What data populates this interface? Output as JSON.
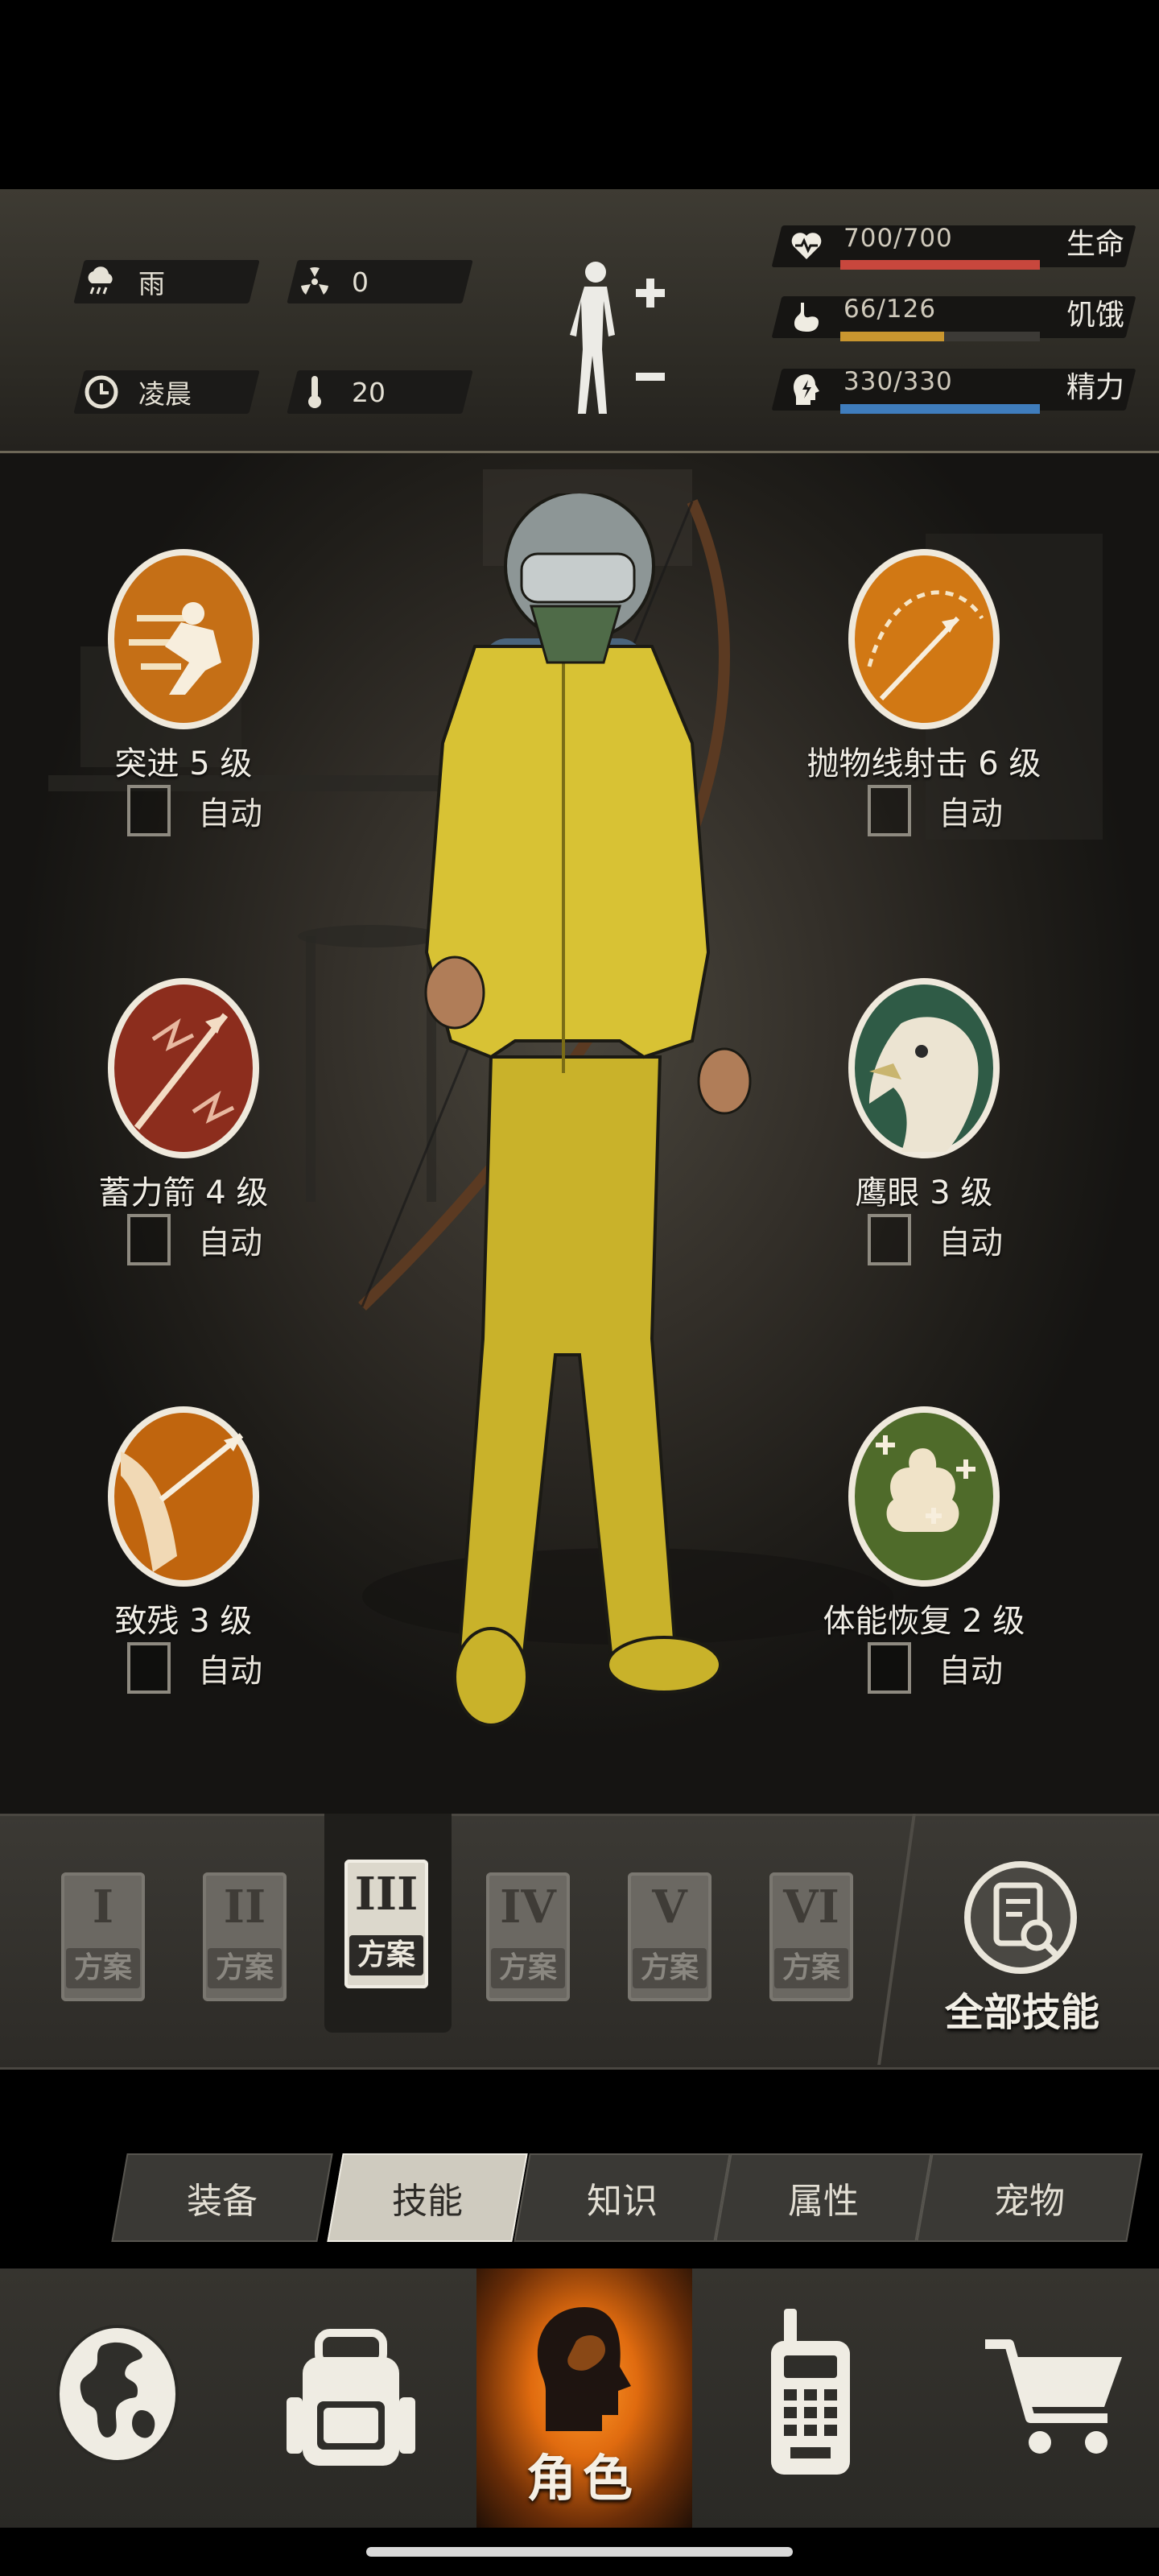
{
  "status": {
    "weather": {
      "icon": "rain-cloud-icon",
      "label": "雨"
    },
    "radiation": {
      "icon": "radiation-icon",
      "value": "0"
    },
    "time_of_day": {
      "icon": "clock-icon",
      "label": "凌晨"
    },
    "temperature": {
      "icon": "thermometer-icon",
      "value": "20"
    },
    "body_icon": "body-figure-icon",
    "bars": [
      {
        "key": "life",
        "label": "生命",
        "value": "700/700",
        "fraction": 1.0,
        "color": "#c8473d",
        "icon": "heart-pulse-icon"
      },
      {
        "key": "hunger",
        "label": "饥饿",
        "value": "66/126",
        "fraction": 0.52,
        "color": "#c9962f",
        "icon": "stomach-icon"
      },
      {
        "key": "energy",
        "label": "精力",
        "value": "330/330",
        "fraction": 1.0,
        "color": "#3f7dbd",
        "icon": "head-energy-icon"
      }
    ]
  },
  "skills": [
    {
      "name": "突进 5 级",
      "auto_label": "自动",
      "icon": "dash-skill-icon"
    },
    {
      "name": "抛物线射击 6 级",
      "auto_label": "自动",
      "icon": "parabolic-shot-skill-icon"
    },
    {
      "name": "蓄力箭 4 级",
      "auto_label": "自动",
      "icon": "charged-arrow-skill-icon"
    },
    {
      "name": "鹰眼 3 级",
      "auto_label": "自动",
      "icon": "eagle-eye-skill-icon"
    },
    {
      "name": "致残 3 级",
      "auto_label": "自动",
      "icon": "cripple-skill-icon"
    },
    {
      "name": "体能恢复 2 级",
      "auto_label": "自动",
      "icon": "stamina-recovery-skill-icon"
    }
  ],
  "plans": [
    {
      "numeral": "I",
      "label": "方案",
      "active": false
    },
    {
      "numeral": "II",
      "label": "方案",
      "active": false
    },
    {
      "numeral": "III",
      "label": "方案",
      "active": true
    },
    {
      "numeral": "IV",
      "label": "方案",
      "active": false
    },
    {
      "numeral": "V",
      "label": "方案",
      "active": false
    },
    {
      "numeral": "VI",
      "label": "方案",
      "active": false
    }
  ],
  "all_skills": {
    "label": "全部技能",
    "icon": "document-search-icon"
  },
  "subtabs": [
    {
      "label": "装备",
      "active": false
    },
    {
      "label": "技能",
      "active": true
    },
    {
      "label": "知识",
      "active": false
    },
    {
      "label": "属性",
      "active": false
    },
    {
      "label": "宠物",
      "active": false
    }
  ],
  "bottom_nav": {
    "world": {
      "icon": "globe-icon"
    },
    "backpack": {
      "icon": "backpack-icon"
    },
    "role": {
      "label": "角色",
      "icon": "head-silhouette-icon"
    },
    "radio": {
      "icon": "walkie-talkie-icon"
    },
    "shop": {
      "icon": "shopping-cart-icon"
    }
  }
}
